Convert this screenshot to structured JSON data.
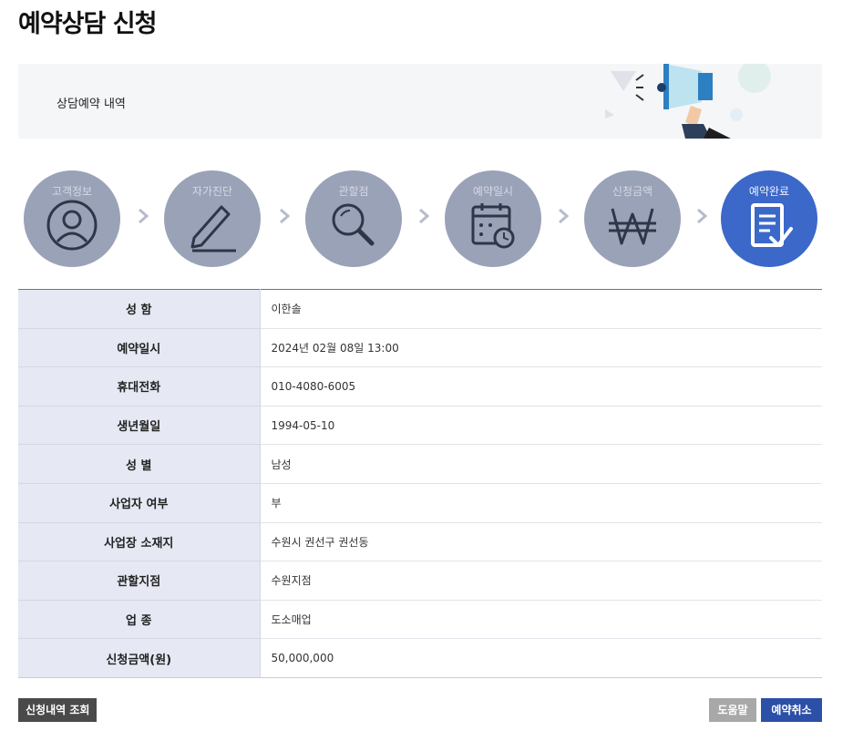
{
  "page": {
    "title": "예약상담 신청"
  },
  "banner": {
    "label": "상담예약 내역"
  },
  "steps": [
    {
      "label": "고객정보",
      "icon": "user-icon",
      "active": false
    },
    {
      "label": "자가진단",
      "icon": "pencil-icon",
      "active": false
    },
    {
      "label": "관할점",
      "icon": "magnifier-icon",
      "active": false
    },
    {
      "label": "예약일시",
      "icon": "calendar-clock-icon",
      "active": false
    },
    {
      "label": "신청금액",
      "icon": "won-icon",
      "active": false
    },
    {
      "label": "예약완료",
      "icon": "document-check-icon",
      "active": true
    }
  ],
  "details": {
    "rows": [
      {
        "label": "성 함",
        "value": "이한솔"
      },
      {
        "label": "예약일시",
        "value": "2024년 02월 08일 13:00"
      },
      {
        "label": "휴대전화",
        "value": "010-4080-6005"
      },
      {
        "label": "생년월일",
        "value": "1994-05-10"
      },
      {
        "label": "성 별",
        "value": "남성"
      },
      {
        "label": "사업자 여부",
        "value": "부"
      },
      {
        "label": "사업장 소재지",
        "value": "수원시 권선구 권선동"
      },
      {
        "label": "관할지점",
        "value": "수원지점"
      },
      {
        "label": "업 종",
        "value": "도소매업"
      },
      {
        "label": "신청금액(원)",
        "value": "50,000,000"
      }
    ]
  },
  "buttons": {
    "history": "신청내역 조회",
    "help": "도움말",
    "cancel": "예약취소"
  },
  "colors": {
    "step_inactive": "#9aa2b8",
    "step_active": "#3b68c9",
    "table_header_bg": "#e6e9f3",
    "btn_dark": "#4a4a4a",
    "btn_gray": "#a8a8a8",
    "btn_blue": "#2c4fa8"
  }
}
